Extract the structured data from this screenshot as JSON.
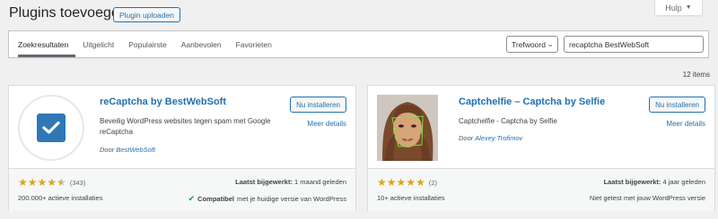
{
  "help": {
    "label": "Hulp",
    "caret": "▼"
  },
  "header": {
    "title": "Plugins toevoegen",
    "upload_label": "Plugin uploaden"
  },
  "tabs": [
    {
      "label": "Zoekresultaten",
      "active": true
    },
    {
      "label": "Uitgelicht"
    },
    {
      "label": "Populairste"
    },
    {
      "label": "Aanbevolen"
    },
    {
      "label": "Favorieten"
    }
  ],
  "search": {
    "type": "Trefwoord",
    "value": "recaptcha BestWebSoft"
  },
  "results": {
    "count_text": "12 items"
  },
  "plugins": [
    {
      "name": "reCaptcha by BestWebSoft",
      "description": "Beveilig WordPress websites tegen spam met Google reCaptcha",
      "author_prefix": "Door",
      "author": "BestWebSoft",
      "install_label": "Nu installeren",
      "details_label": "Meer details",
      "rating_stars": 4.5,
      "rating_count": "(343)",
      "installs": "200.000+ actieve installaties",
      "updated_label": "Laatst bijgewerkt:",
      "updated_value": "1 maand geleden",
      "compat_bold": "Compatibel",
      "compat_text": "met je huidige versie van WordPress",
      "icon": "checkmark-icon"
    },
    {
      "name": "Captchelfie – Captcha by Selfie",
      "description": "Captchelfie - Captcha by Selfie",
      "author_prefix": "Door",
      "author": "Alexey Trofimov",
      "install_label": "Nu installeren",
      "details_label": "Meer details",
      "rating_stars": 5,
      "rating_count": "(2)",
      "installs": "10+ actieve installaties",
      "updated_label": "Laatst bijgewerkt:",
      "updated_value": "4 jaar geleden",
      "compat_text": "Niet getest met jouw WordPress versie",
      "icon": "face-photo-icon"
    }
  ],
  "colors": {
    "link": "#2271b1",
    "star": "#dba617",
    "check": "#00a32a"
  }
}
